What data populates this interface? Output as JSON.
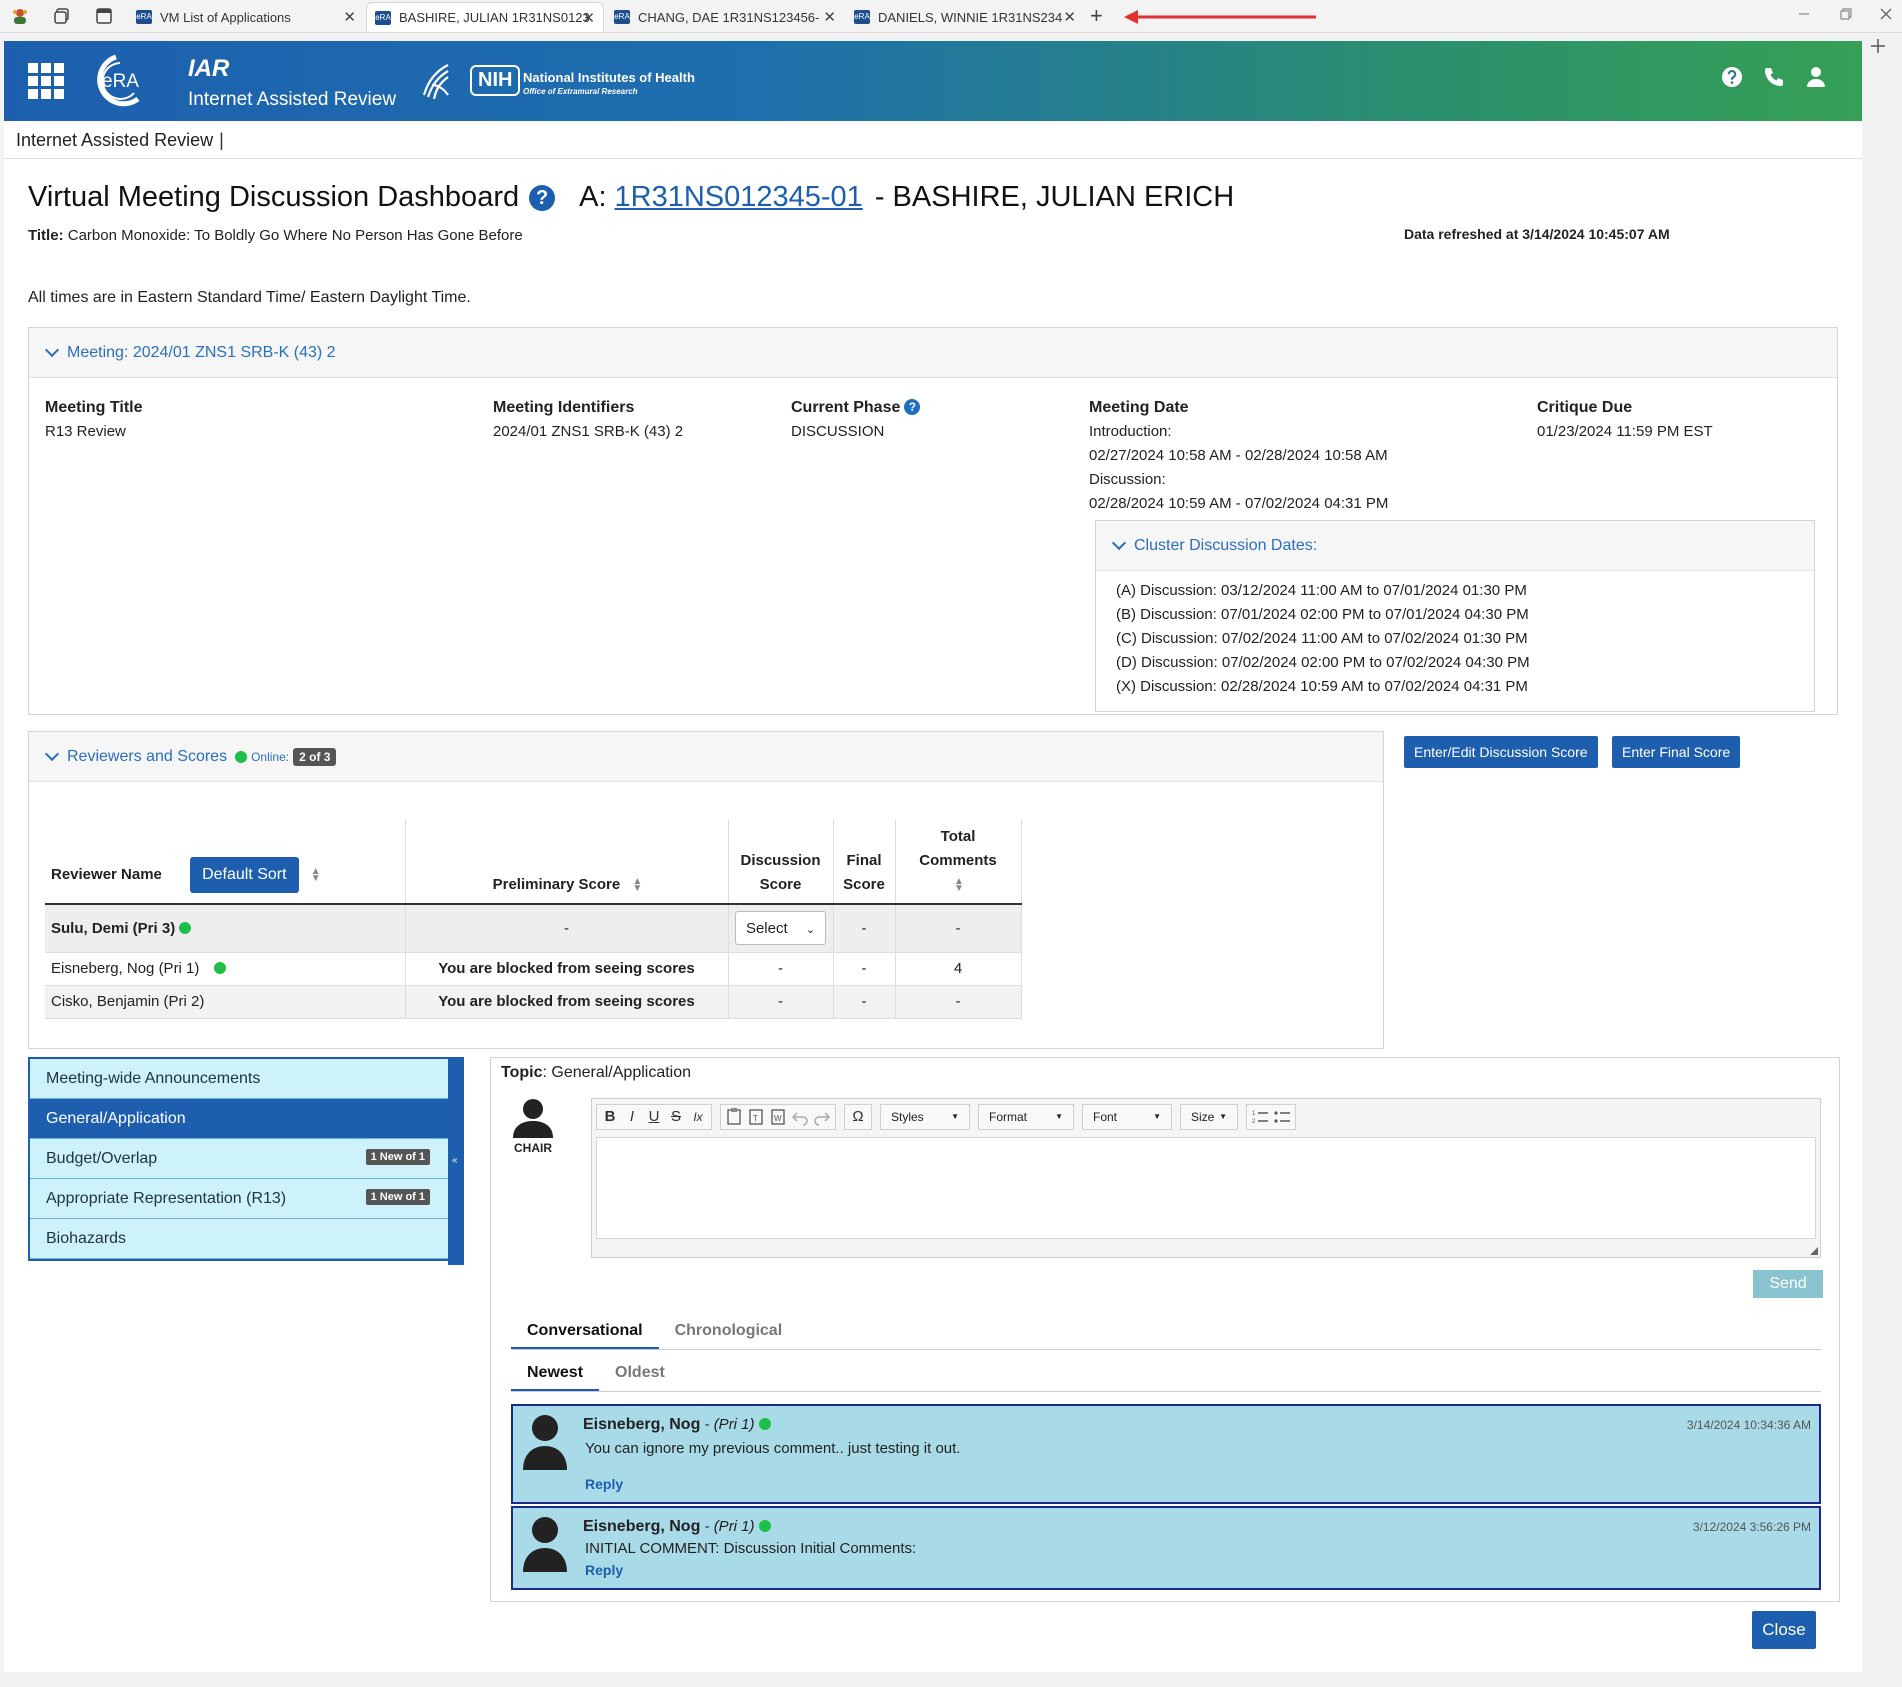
{
  "browser": {
    "tabs": [
      {
        "fav": "eRA",
        "title": "VM List of Applications"
      },
      {
        "fav": "eRA",
        "title": "BASHIRE, JULIAN 1R31NS0123"
      },
      {
        "fav": "eRA",
        "title": "CHANG, DAE 1R31NS123456-"
      },
      {
        "fav": "eRA",
        "title": "DANIELS, WINNIE 1R31NS234"
      }
    ],
    "close_glyph": "✕",
    "new_tab_glyph": "+",
    "annotation_color": "#e03030"
  },
  "header": {
    "logo_text": "eRA",
    "app_short": "IAR",
    "app_full": "Internet Assisted Review",
    "nih_box": "NIH",
    "nih_line1": "National Institutes of Health",
    "nih_line2": "Office of Extramural Research",
    "icons": [
      "help-icon",
      "phone-icon",
      "user-icon"
    ]
  },
  "breadcrumb": {
    "label": "Internet Assisted Review",
    "sep": "|"
  },
  "page": {
    "heading": "Virtual Meeting Discussion Dashboard",
    "app_prefix": "A:",
    "app_number": "1R31NS012345-01",
    "applicant": "- BASHIRE, JULIAN ERICH",
    "title_label": "Title:",
    "title_value": "Carbon Monoxide: To Boldly Go Where No Person Has Gone Before",
    "refreshed": "Data refreshed at 3/14/2024 10:45:07 AM",
    "tz_note": "All times are in Eastern Standard Time/ Eastern Daylight Time."
  },
  "meeting": {
    "header": "Meeting:  2024/01 ZNS1 SRB-K (43) 2",
    "title_label": "Meeting Title",
    "title_value": "R13 Review",
    "ids_label": "Meeting Identifiers",
    "ids_value": "2024/01 ZNS1 SRB-K (43) 2",
    "phase_label": "Current Phase",
    "phase_value": "DISCUSSION",
    "date_label": "Meeting Date",
    "date_lines": [
      "Introduction:",
      "02/27/2024 10:58 AM - 02/28/2024 10:58 AM",
      "Discussion:",
      "02/28/2024 10:59 AM - 07/02/2024 04:31 PM"
    ],
    "critique_label": "Critique Due",
    "critique_value": "01/23/2024 11:59 PM EST",
    "cluster_header": "Cluster Discussion Dates:",
    "cluster_rows": [
      "(A) Discussion: 03/12/2024 11:00 AM  to 07/01/2024 01:30 PM",
      "(B) Discussion: 07/01/2024 02:00 PM  to 07/01/2024 04:30 PM",
      "(C) Discussion: 07/02/2024 11:00 AM  to 07/02/2024 01:30 PM",
      "(D) Discussion: 07/02/2024 02:00 PM  to 07/02/2024 04:30 PM",
      "(X) Discussion: 02/28/2024 10:59 AM  to 07/02/2024 04:31 PM"
    ]
  },
  "reviewers": {
    "header": "Reviewers and Scores",
    "online_label": "Online:",
    "online_count": "2 of 3",
    "btn_discussion": "Enter/Edit Discussion Score",
    "btn_final": "Enter Final Score",
    "columns": {
      "name": "Reviewer Name",
      "default_sort": "Default Sort",
      "prelim": "Preliminary Score",
      "disc1": "Discussion",
      "disc2": "Score",
      "final1": "Final",
      "final2": "Score",
      "total1": "Total",
      "total2": "Comments"
    },
    "rows": [
      {
        "name": "Sulu, Demi (Pri 3)",
        "prelim": "-",
        "disc": "Select",
        "final": "-",
        "total": "-"
      },
      {
        "name": "Eisneberg, Nog (Pri 1)",
        "prelim": "You are blocked from seeing scores",
        "disc": "-",
        "final": "-",
        "total": "4"
      },
      {
        "name": "Cisko, Benjamin (Pri 2)",
        "prelim": "You are blocked from seeing scores",
        "disc": "-",
        "final": "-",
        "total": "-"
      }
    ]
  },
  "topics": {
    "items": [
      {
        "label": "Meeting-wide Announcements",
        "badge": ""
      },
      {
        "label": "General/Application",
        "badge": ""
      },
      {
        "label": "Budget/Overlap",
        "badge": "1 New of 1"
      },
      {
        "label": "Appropriate Representation (R13)",
        "badge": "1 New of 1"
      },
      {
        "label": "Biohazards",
        "badge": ""
      }
    ],
    "collapse_glyph": "«"
  },
  "discussion": {
    "topic_label": "Topic",
    "topic_value": ": General/Application",
    "chair_label": "CHAIR",
    "toolbar": {
      "bold": "B",
      "italic": "I",
      "underline": "U",
      "strike": "S",
      "clear": "Ix",
      "special": "Ω",
      "styles": "Styles",
      "format": "Format",
      "font": "Font",
      "size": "Size"
    },
    "send": "Send",
    "tab_conv": "Conversational",
    "tab_chron": "Chronological",
    "tab_newest": "Newest",
    "tab_oldest": "Oldest",
    "comments": [
      {
        "name": "Eisneberg, Nog",
        "role": " - (Pri 1)",
        "time": "3/14/2024 10:34:36 AM",
        "text": "You can ignore my previous comment.. just testing it out.",
        "reply": "Reply"
      },
      {
        "name": "Eisneberg, Nog",
        "role": " - (Pri 1)",
        "time": "3/12/2024 3:56:26 PM",
        "text": "INITIAL COMMENT: Discussion Initial Comments:",
        "reply": "Reply"
      }
    ],
    "close": "Close"
  }
}
